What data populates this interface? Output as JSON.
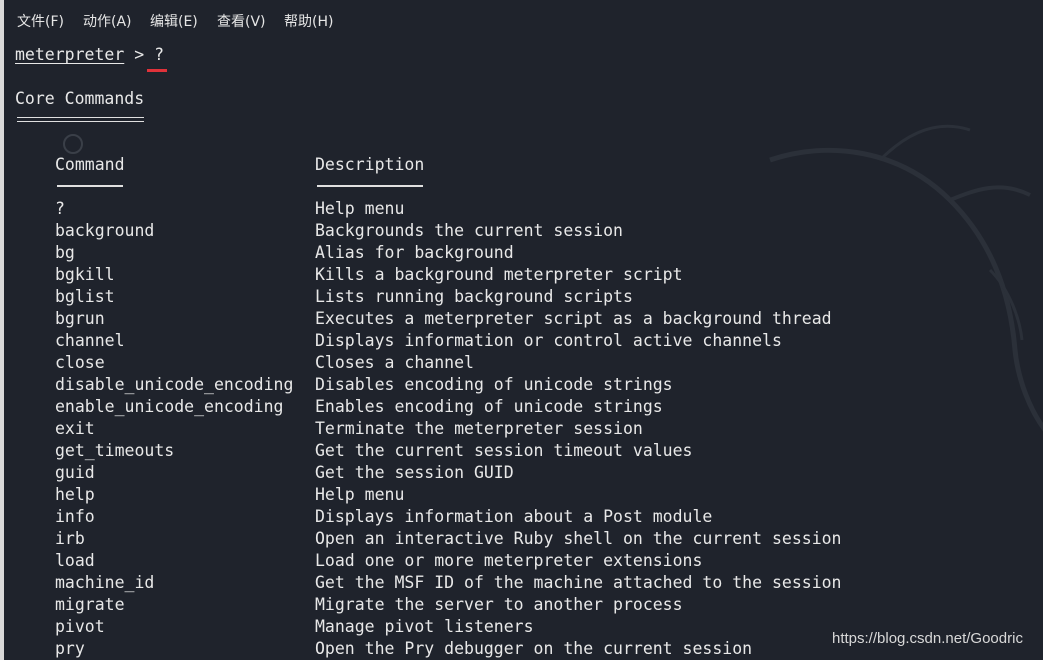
{
  "menubar": {
    "items": [
      {
        "label": "文件(F)"
      },
      {
        "label": "动作(A)"
      },
      {
        "label": "编辑(E)"
      },
      {
        "label": "查看(V)"
      },
      {
        "label": "帮助(H)"
      }
    ]
  },
  "terminal": {
    "prompt": "meterpreter",
    "prompt_suffix": " > ?",
    "section_title": "Core Commands",
    "header_command": "Command",
    "header_description": "Description",
    "commands": [
      {
        "name": "?",
        "desc": "Help menu"
      },
      {
        "name": "background",
        "desc": "Backgrounds the current session"
      },
      {
        "name": "bg",
        "desc": "Alias for background"
      },
      {
        "name": "bgkill",
        "desc": "Kills a background meterpreter script"
      },
      {
        "name": "bglist",
        "desc": "Lists running background scripts"
      },
      {
        "name": "bgrun",
        "desc": "Executes a meterpreter script as a background thread"
      },
      {
        "name": "channel",
        "desc": "Displays information or control active channels"
      },
      {
        "name": "close",
        "desc": "Closes a channel"
      },
      {
        "name": "disable_unicode_encoding",
        "desc": "Disables encoding of unicode strings"
      },
      {
        "name": "enable_unicode_encoding",
        "desc": "Enables encoding of unicode strings"
      },
      {
        "name": "exit",
        "desc": "Terminate the meterpreter session"
      },
      {
        "name": "get_timeouts",
        "desc": "Get the current session timeout values"
      },
      {
        "name": "guid",
        "desc": "Get the session GUID"
      },
      {
        "name": "help",
        "desc": "Help menu"
      },
      {
        "name": "info",
        "desc": "Displays information about a Post module"
      },
      {
        "name": "irb",
        "desc": "Open an interactive Ruby shell on the current session"
      },
      {
        "name": "load",
        "desc": "Load one or more meterpreter extensions"
      },
      {
        "name": "machine_id",
        "desc": "Get the MSF ID of the machine attached to the session"
      },
      {
        "name": "migrate",
        "desc": "Migrate the server to another process"
      },
      {
        "name": "pivot",
        "desc": "Manage pivot listeners"
      },
      {
        "name": "pry",
        "desc": "Open the Pry debugger on the current session"
      }
    ]
  },
  "watermark": "https://blog.csdn.net/Goodric",
  "colors": {
    "background": "#1f232c",
    "text": "#e8e8e8",
    "cursor_underline": "#e0323a"
  }
}
